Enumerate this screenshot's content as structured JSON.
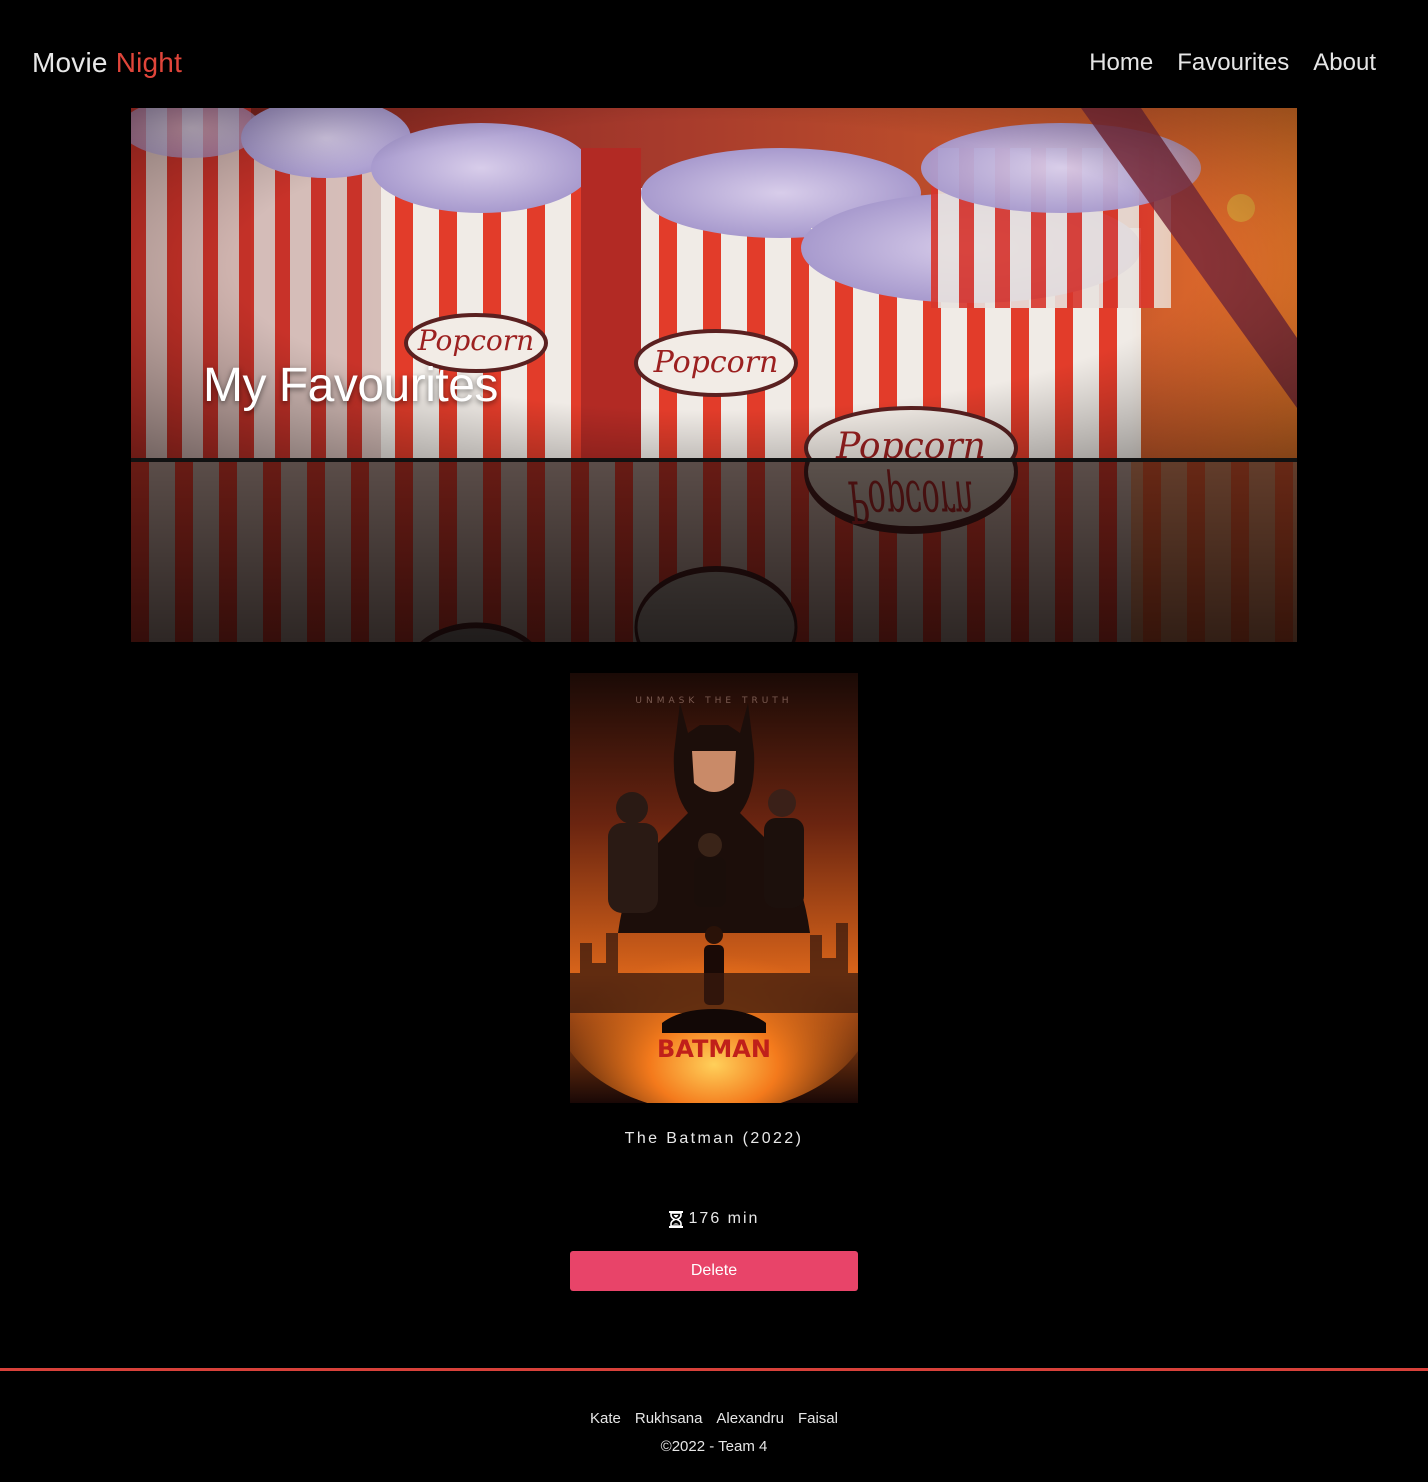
{
  "brand": {
    "part1": "Movie",
    "part2": "Night",
    "accent_color": "#e0453a"
  },
  "nav": {
    "items": [
      "Home",
      "Favourites",
      "About"
    ]
  },
  "hero": {
    "title": "My Favourites",
    "image": "popcorn-boxes-banner"
  },
  "favourites": [
    {
      "title": "The Batman (2022)",
      "runtime": "176 min",
      "poster": "the-batman-poster",
      "delete_label": "Delete"
    }
  ],
  "colors": {
    "delete_button": "#e84469",
    "footer_rule": "#d8413a",
    "background": "#000000"
  },
  "icons": {
    "runtime": "hourglass-icon"
  },
  "footer": {
    "team": [
      "Kate",
      "Rukhsana",
      "Alexandru",
      "Faisal"
    ],
    "copyright": "©2022 - Team 4"
  }
}
